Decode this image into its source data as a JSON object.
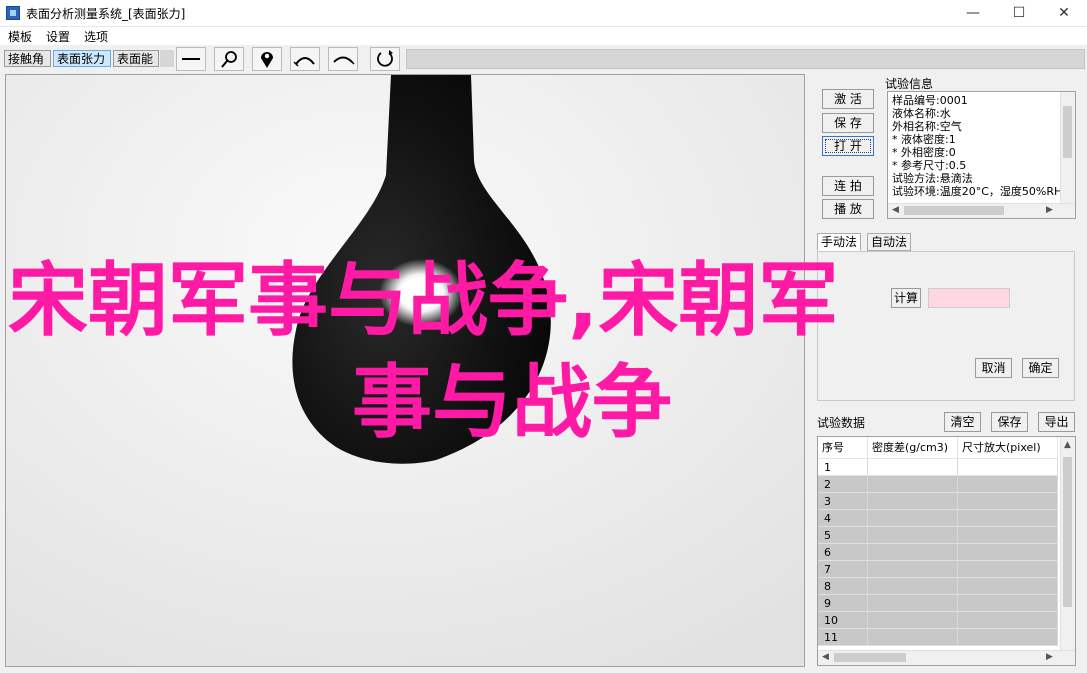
{
  "window": {
    "title": "表面分析测量系统_[表面张力]",
    "minimize": "—",
    "maximize": "☐",
    "close": "✕"
  },
  "menu": [
    "模板",
    "设置",
    "选项"
  ],
  "toolbar": {
    "tabs": [
      "接触角",
      "表面张力",
      "表面能"
    ],
    "active_tab": "表面张力",
    "tools": [
      {
        "name": "line-tool-icon",
        "glyph": "—"
      },
      {
        "name": "magnify-icon",
        "glyph": "⚲"
      },
      {
        "name": "location-pin-icon",
        "glyph": "⬤"
      },
      {
        "name": "arc-up-icon",
        "glyph": "⌒"
      },
      {
        "name": "arc-down-icon",
        "glyph": "⌒"
      },
      {
        "name": "refresh-icon",
        "glyph": "↻"
      }
    ]
  },
  "controls": {
    "activate": "激 活",
    "save": "保 存",
    "open": "打 开",
    "burst": "连 拍",
    "play": "播 放"
  },
  "info": {
    "label": "试验信息",
    "lines": [
      "样品编号:0001",
      "液体名称:水",
      "外相名称:空气",
      "* 液体密度:1",
      "* 外相密度:0",
      "* 参考尺寸:0.5",
      "试验方法:悬滴法",
      "试验环境:温度20°C，湿度50%RH"
    ]
  },
  "method": {
    "tabs": [
      "手动法",
      "自动法"
    ],
    "calc_label": "计算",
    "cancel": "取消",
    "confirm": "确定"
  },
  "data_section": {
    "label": "试验数据",
    "clear": "清空",
    "save": "保存",
    "export": "导出",
    "columns": [
      "序号",
      "密度差(g/cm3)",
      "尺寸放大(pixel)"
    ],
    "rows": [
      "1",
      "2",
      "3",
      "4",
      "5",
      "6",
      "7",
      "8",
      "9",
      "10",
      "11"
    ]
  },
  "overlay": {
    "line1": "宋朝军事与战争,宋朝军",
    "line2": "事与战争"
  }
}
